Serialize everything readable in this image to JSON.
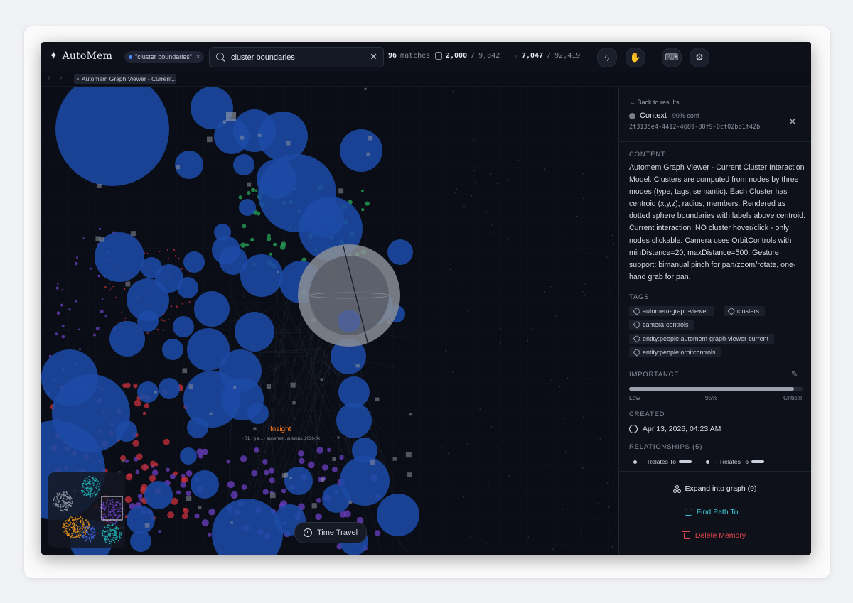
{
  "app": {
    "brand": "AutoMem",
    "filter_chip": "\"cluster boundaries\"",
    "search": {
      "value": "cluster boundaries",
      "placeholder": ""
    },
    "matches": {
      "count": "96",
      "label": "matches"
    },
    "nodes": {
      "shown": "2,000",
      "total": "9,842"
    },
    "edges": {
      "shown": "7,047",
      "total": "92,419"
    }
  },
  "subbar": {
    "tab_label": "Automem Graph Viewer - Current..."
  },
  "canvas": {
    "time_travel": "Time Travel",
    "insight_label": "Insight",
    "insight_sub": "· 71 · g e... · automem, autobus, 2026-0x",
    "dot_label": "· · · · ·",
    "colors": {
      "cluster_blue": "#1c4aa6",
      "green": "#2aa55a",
      "purple": "#6c3fc4",
      "red": "#c7303c",
      "orange": "#ff7a1a",
      "teal": "#1fb3b3"
    }
  },
  "panel": {
    "back": "Back to results",
    "type": "Context",
    "conf": "90% conf",
    "id": "2f3135e4-4412-4689-88f9-0cf02bb1f42b",
    "content_title": "CONTENT",
    "content": "Automem Graph Viewer - Current Cluster Interaction Model: Clusters are computed from nodes by three modes (type, tags, semantic). Each Cluster has centroid (x,y,z), radius, members. Rendered as dotted sphere boundaries with labels above centroid. Current interaction: NO cluster hover/click - only nodes clickable. Camera uses OrbitControls with minDistance=20, maxDistance=500. Gesture support: bimanual pinch for pan/zoom/rotate, one-hand grab for pan.",
    "tags_title": "TAGS",
    "tags": [
      "automem-graph-viewer",
      "clusters",
      "camera-controls",
      "entity:people:automem-graph-viewer-current",
      "entity:people:orbitcontrols"
    ],
    "importance_title": "IMPORTANCE",
    "importance": {
      "value": 0.95,
      "low": "Low",
      "pct": "95%",
      "high": "Critical"
    },
    "created_title": "CREATED",
    "created": "Apr 13, 2026, 04:23 AM",
    "relationships_title": "RELATIONSHIPS (5)",
    "relations": [
      {
        "label": "Relates To"
      },
      {
        "label": "Relates To"
      }
    ],
    "actions": {
      "expand": "Expand into graph (9)",
      "path": "Find Path To...",
      "delete": "Delete Memory"
    }
  }
}
